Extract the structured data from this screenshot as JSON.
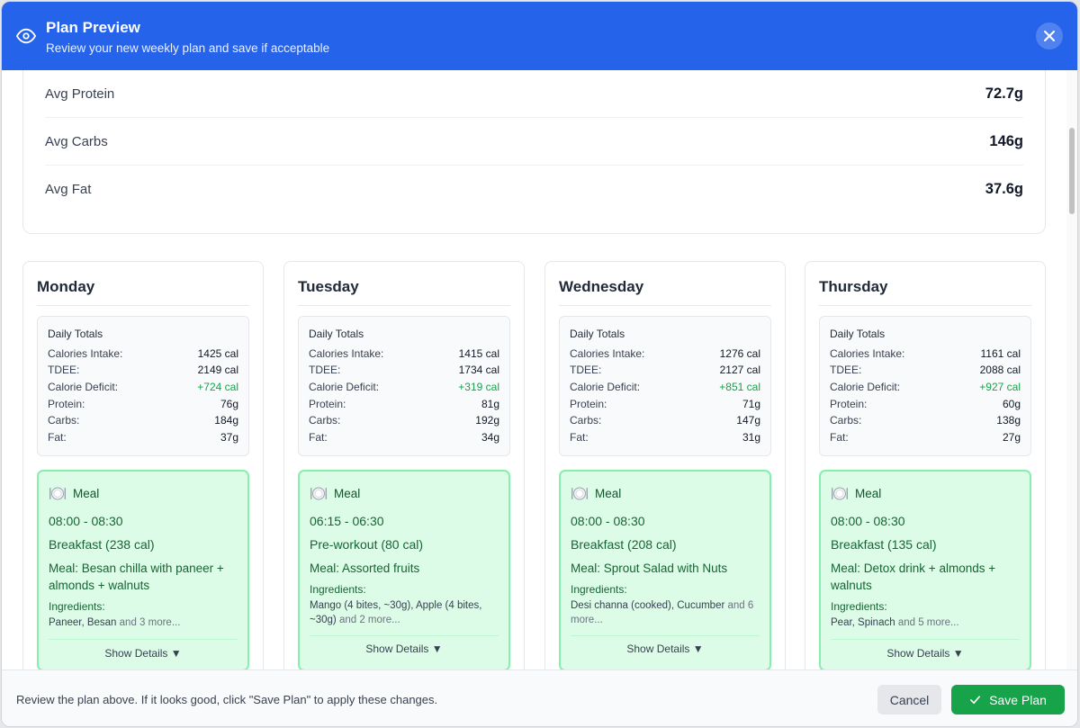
{
  "header": {
    "title": "Plan Preview",
    "subtitle": "Review your new weekly plan and save if acceptable",
    "icon": "eye-icon",
    "close_icon": "close-icon"
  },
  "summary": [
    {
      "label": "Avg Protein",
      "value": "72.7g"
    },
    {
      "label": "Avg Carbs",
      "value": "146g"
    },
    {
      "label": "Avg Fat",
      "value": "37.6g"
    }
  ],
  "labels": {
    "daily_totals": "Daily Totals",
    "calories_intake": "Calories Intake:",
    "tdee": "TDEE:",
    "calorie_deficit": "Calorie Deficit:",
    "protein": "Protein:",
    "carbs": "Carbs:",
    "fat": "Fat:",
    "meal": "Meal",
    "meal_prefix": "Meal:",
    "ingredients": "Ingredients:",
    "show_details": "Show Details ▼"
  },
  "days": [
    {
      "name": "Monday",
      "totals": {
        "intake": "1425 cal",
        "tdee": "2149 cal",
        "deficit": "+724 cal",
        "protein": "76g",
        "carbs": "184g",
        "fat": "37g"
      },
      "meal": {
        "time": "08:00 - 08:30",
        "type": "Breakfast (238 cal)",
        "name": "Besan chilla with paneer + almonds + walnuts",
        "ingredients": "Paneer, Besan",
        "more": "and 3 more..."
      }
    },
    {
      "name": "Tuesday",
      "totals": {
        "intake": "1415 cal",
        "tdee": "1734 cal",
        "deficit": "+319 cal",
        "protein": "81g",
        "carbs": "192g",
        "fat": "34g"
      },
      "meal": {
        "time": "06:15 - 06:30",
        "type": "Pre-workout (80 cal)",
        "name": "Assorted fruits",
        "ingredients": "Mango (4 bites, ~30g), Apple (4 bites, ~30g)",
        "more": "and 2 more..."
      }
    },
    {
      "name": "Wednesday",
      "totals": {
        "intake": "1276 cal",
        "tdee": "2127 cal",
        "deficit": "+851 cal",
        "protein": "71g",
        "carbs": "147g",
        "fat": "31g"
      },
      "meal": {
        "time": "08:00 - 08:30",
        "type": "Breakfast (208 cal)",
        "name": "Sprout Salad with Nuts",
        "ingredients": "Desi channa (cooked), Cucumber",
        "more": "and 6 more..."
      }
    },
    {
      "name": "Thursday",
      "totals": {
        "intake": "1161 cal",
        "tdee": "2088 cal",
        "deficit": "+927 cal",
        "protein": "60g",
        "carbs": "138g",
        "fat": "27g"
      },
      "meal": {
        "time": "08:00 - 08:30",
        "type": "Breakfast (135 cal)",
        "name": "Detox drink + almonds + walnuts",
        "ingredients": "Pear, Spinach",
        "more": "and 5 more..."
      }
    }
  ],
  "footer": {
    "message": "Review the plan above. If it looks good, click \"Save Plan\" to apply these changes.",
    "cancel_label": "Cancel",
    "save_label": "Save Plan"
  },
  "colors": {
    "header_bg": "#2563eb",
    "meal_bg": "#dcfce7",
    "meal_border": "#86efac",
    "deficit": "#16a34a",
    "save_button": "#16a34a"
  }
}
